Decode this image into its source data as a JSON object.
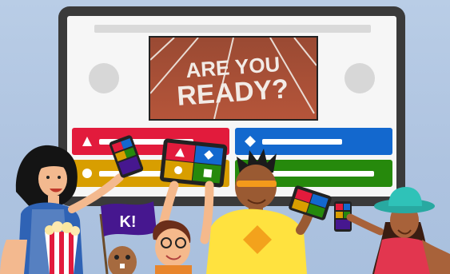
{
  "hero": {
    "line1": "ARE YOU",
    "line2": "READY?"
  },
  "flag": {
    "text": "K!"
  },
  "answers": [
    {
      "color": "#e21b3c",
      "icon": "triangle-icon"
    },
    {
      "color": "#1368ce",
      "icon": "diamond-icon"
    },
    {
      "color": "#d89e00",
      "icon": "circle-icon"
    },
    {
      "color": "#26890c",
      "icon": "square-icon"
    }
  ],
  "colors": {
    "background": "#b9cde6",
    "monitor": "#3a3a3a",
    "red": "#e21b3c",
    "blue": "#1368ce",
    "yellow": "#d89e00",
    "green": "#26890c",
    "flag": "#46178f"
  }
}
